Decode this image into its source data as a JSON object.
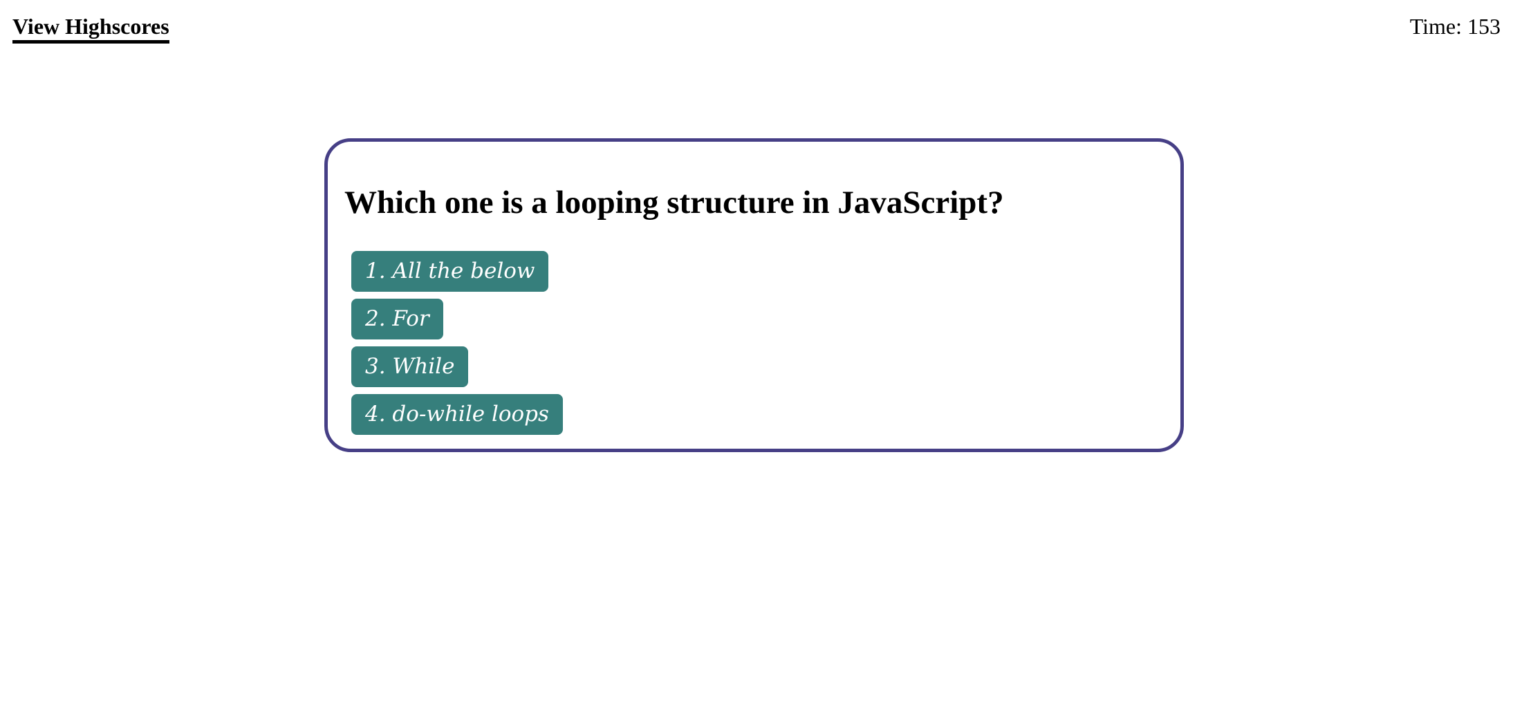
{
  "header": {
    "highscores_label": "View Highscores",
    "timer_text": "Time: 153"
  },
  "quiz": {
    "question": "Which one is a looping structure in JavaScript?",
    "choices": [
      {
        "label": "1. All the below"
      },
      {
        "label": "2. For"
      },
      {
        "label": "3. While"
      },
      {
        "label": "4. do-while loops"
      }
    ]
  },
  "colors": {
    "card_border": "#463f86",
    "choice_background": "#367f7c",
    "choice_text": "#ffffff",
    "page_background": "#ffffff"
  }
}
